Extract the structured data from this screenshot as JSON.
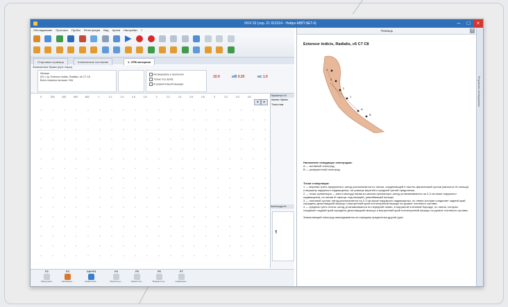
{
  "window": {
    "title": "NVX 52 (сер. 21 912014 - Нейро-МВП NET.4)",
    "buttons": {
      "minimize": "–",
      "maximize": "□",
      "close": "×"
    }
  },
  "menu": [
    "Обследование",
    "Протокол",
    "Пробы",
    "Регистрация",
    "Вид",
    "Архив",
    "Настройки",
    "?"
  ],
  "tabs": [
    "Стартовая страница",
    "Клиническое состояние",
    "1. СРВ моторная"
  ],
  "settings": {
    "header": "Записанные буквы (нрп: пары)",
    "muscle_label": "Мышца:",
    "muscle_value": "(R) 1 эр, Extensor indicis, Radialis, c6 C7 C8",
    "hint": "Всего нервных волокон: N/A",
    "check1": "Активировать в протоколе",
    "check2": "Только эту пробу",
    "check3": "В сравнительной мышцах",
    "param1_value": "10.0",
    "param2_label": "мВ",
    "param2_value": "0.20",
    "param3_label": "мс",
    "param3_value": "1.0"
  },
  "chart": {
    "x_ticks": [
      "0",
      "200",
      "400",
      "600",
      "800",
      "1",
      "1.2",
      "1.4",
      "1.6",
      "1.8",
      "2",
      "2.2",
      "2.4",
      "2.6",
      "2.8",
      "3",
      "3.2",
      "3.4",
      "3.6"
    ],
    "nav_prev": "◄",
    "nav_next": "►"
  },
  "right_pane": {
    "header1": "Параметры М",
    "sub1": "Амплит.",
    "sub2": "Время",
    "item1": "Точка стим.",
    "header2": "Амплитуды М",
    "axis": "мВ"
  },
  "footer": [
    {
      "key": "F2",
      "label": "Ввод реакт."
    },
    {
      "key": "F3",
      "label": "Связанные..."
    },
    {
      "key": "Ctrl+F4",
      "label": "Новая проб..."
    },
    {
      "key": "F4",
      "label": "Пометить р..."
    },
    {
      "key": "F5",
      "label": "Новая в пр..."
    },
    {
      "key": "F6",
      "label": "Вперед в пр..."
    },
    {
      "key": "F7",
      "label": "Сравнение..."
    }
  ],
  "help": {
    "header": "Помощь",
    "close": "×",
    "title": "Extensor indicis, Radialis, c6 C7 C8",
    "electrodes_heading": "Наложение отводящих электродов:",
    "electrode_a": "А — активный электрод;",
    "electrode_b": "В — референтный электрод.",
    "points_heading": "Точки стимуляции:",
    "p1": "1 — верхняя треть предплечья: катод располагается по линии, соединяющей II пястно-фаланговый сустав (запястье III пальца) и вершину наружного надмыщелка, на границе верхней и средней третей предплечья.",
    "p2": "2 — точка супинатора — место выхода нерва из канала супинатора: катод устанавливается на 2-3 см ниже наружного надмыщелка, по линии III пальца, над мышцей, разгибающей пальцы.",
    "p3": "3 — локтевой сустав: катод располагается на 2-3 см выше наружного надмыщелка, по линии которая соединяет задний край середины дельтовидной мышцы и внутренний край плечелучевой мышцы на уровне локтевого сустава.",
    "p4": "4 — средняя треть плеча: катод устанавливается по передней линии, в наружной плечевой борозде, по линии, которая соединяет задний край середины дельтовидной мышцы и внутренний край плечелучевой мышцы на уровне локтевого сустава.",
    "ground": "Заземляющий электрод накладывается на середину предплечья другой руки."
  },
  "side_strip": {
    "label": "Результаты обследования"
  },
  "colors": {
    "accent": "#2f6fb8",
    "close": "#d6362c",
    "marker_red": "#c23b2b"
  }
}
